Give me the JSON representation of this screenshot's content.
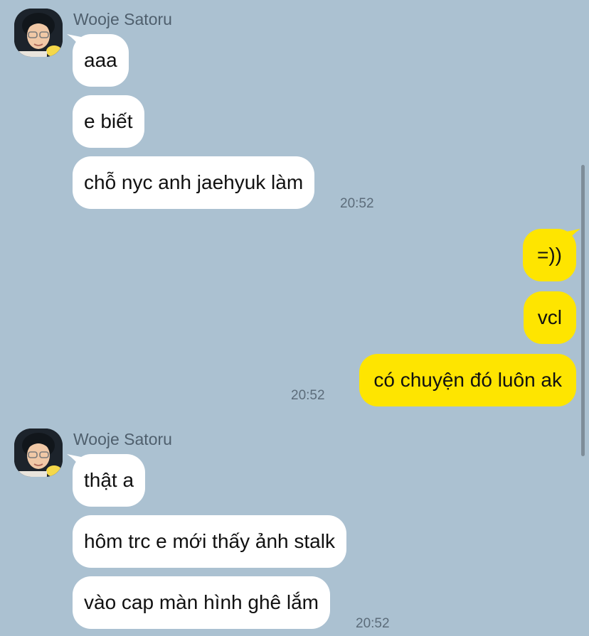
{
  "colors": {
    "background": "#abc1d1",
    "incoming_bubble": "#ffffff",
    "outgoing_bubble": "#fee500",
    "timestamp": "#5c6c7a",
    "sender_name": "#4f5f6d"
  },
  "groups": [
    {
      "direction": "incoming",
      "sender": "Wooje Satoru",
      "avatar_icon": "profile-photo-icon",
      "messages": [
        "aaa",
        "e biết",
        "chỗ nyc anh jaehyuk làm"
      ],
      "time": "20:52"
    },
    {
      "direction": "outgoing",
      "messages": [
        "=))",
        "vcl",
        "có chuyện đó luôn ak"
      ],
      "time": "20:52"
    },
    {
      "direction": "incoming",
      "sender": "Wooje Satoru",
      "avatar_icon": "profile-photo-icon",
      "messages": [
        "thật a",
        "hôm trc e mới thấy ảnh stalk",
        "vào cap màn hình ghê lắm"
      ],
      "time": "20:52"
    }
  ]
}
